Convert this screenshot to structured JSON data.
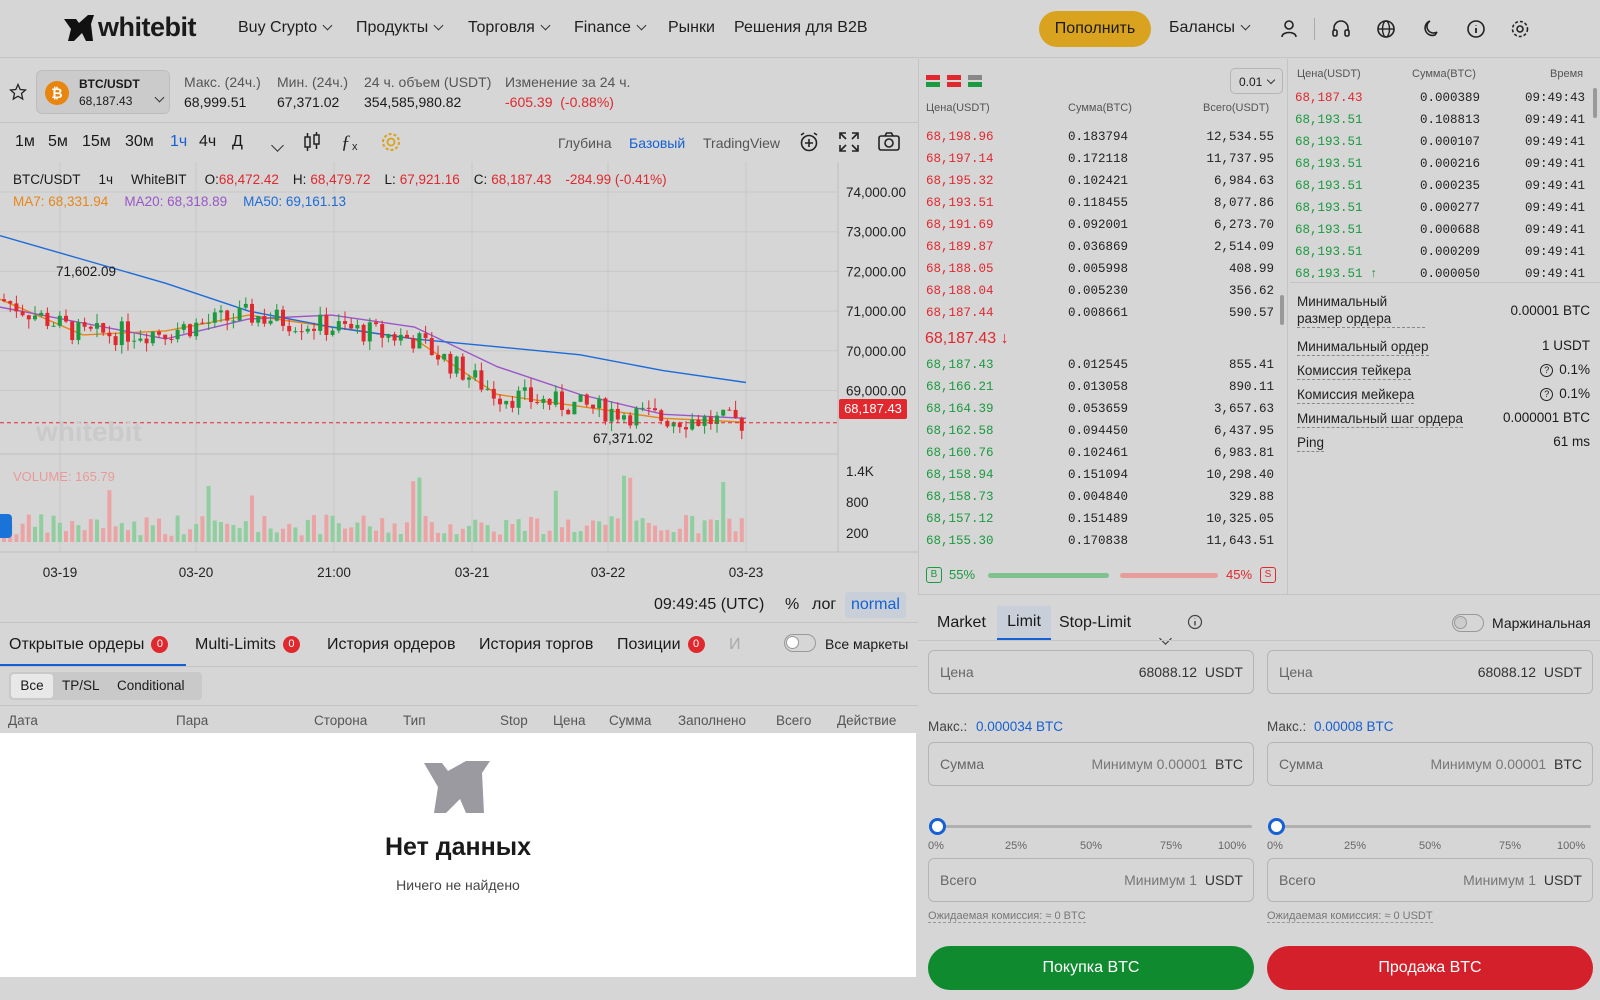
{
  "brand": {
    "name": "whitebit"
  },
  "nav": {
    "items": [
      "Buy Crypto",
      "Продукты",
      "Торговля",
      "Finance",
      "Рынки",
      "Решения для B2B"
    ],
    "deposit": "Пополнить",
    "balances": "Балансы"
  },
  "ticker": {
    "pair": "BTC/USDT",
    "price": "68,187.43",
    "stats": [
      {
        "label": "Макс. (24ч.)",
        "value": "68,999.51"
      },
      {
        "label": "Мин. (24ч.)",
        "value": "67,371.02"
      },
      {
        "label": "24 ч. объем (USDT)",
        "value": "354,585,980.82"
      },
      {
        "label": "Изменение за 24 ч.",
        "value": "-605.39  (-0.88%)"
      }
    ]
  },
  "chart_toolbar": {
    "timeframes": [
      "1м",
      "5м",
      "15м",
      "30м",
      "1ч",
      "4ч",
      "Д"
    ],
    "active": "1ч",
    "views": [
      "Глубина",
      "Базовый",
      "TradingView"
    ],
    "active_view": "Базовый"
  },
  "chart_legend": {
    "pair": "BTC/USDT",
    "interval": "1ч",
    "exchange": "WhiteBIT",
    "o_label": "O:",
    "o": "68,472.42",
    "h_label": "H:",
    "h": "68,479.72",
    "l_label": "L:",
    "l": "67,921.16",
    "c_label": "C:",
    "c": "68,187.43",
    "change": "-284.99 (-0.41%)",
    "ma7": "MA7: 68,331.94",
    "ma20": "MA20: 68,318.89",
    "ma50": "MA50: 69,161.13",
    "volume": "VOLUME: 165.79",
    "high_mark": "71,602.09",
    "low_mark": "67,371.02",
    "last_price_tag": "68,187.43"
  },
  "chart_data": {
    "type": "line",
    "x": [
      "03-19",
      "03-20",
      "21:00",
      "03-21",
      "03-22",
      "03-23"
    ],
    "ylim": [
      67000,
      74500
    ],
    "y_ticks": [
      "74,000.00",
      "73,000.00",
      "72,000.00",
      "71,000.00",
      "70,000.00",
      "69,000.00"
    ],
    "volume_ticks": [
      "1.4K",
      "800",
      "200"
    ],
    "series": [
      {
        "name": "MA7",
        "values": [
          71300,
          70400,
          70500,
          70900,
          70600,
          70300,
          68900,
          68600,
          68300,
          68200
        ]
      },
      {
        "name": "MA20",
        "values": [
          71100,
          70700,
          70300,
          70800,
          70900,
          70600,
          69600,
          68900,
          68400,
          68300
        ]
      },
      {
        "name": "MA50",
        "values": [
          72900,
          72300,
          71700,
          71000,
          70600,
          70300,
          70100,
          69900,
          69500,
          69200
        ]
      }
    ]
  },
  "chart_footer": {
    "time": "09:49:45 (UTC)",
    "pct": "%",
    "log": "лог",
    "mode": "normal"
  },
  "orderbook": {
    "precision": "0.01",
    "headers": [
      "Цена(USDT)",
      "Сумма(BTC)",
      "Всего(USDT)"
    ],
    "asks": [
      [
        "68,198.96",
        "0.183794",
        "12,534.55"
      ],
      [
        "68,197.14",
        "0.172118",
        "11,737.95"
      ],
      [
        "68,195.32",
        "0.102421",
        "6,984.63"
      ],
      [
        "68,193.51",
        "0.118455",
        "8,077.86"
      ],
      [
        "68,191.69",
        "0.092001",
        "6,273.70"
      ],
      [
        "68,189.87",
        "0.036869",
        "2,514.09"
      ],
      [
        "68,188.05",
        "0.005998",
        "408.99"
      ],
      [
        "68,188.04",
        "0.005230",
        "356.62"
      ],
      [
        "68,187.44",
        "0.008661",
        "590.57"
      ]
    ],
    "mid": "68,187.43 ↓",
    "bids": [
      [
        "68,187.43",
        "0.012545",
        "855.41"
      ],
      [
        "68,166.21",
        "0.013058",
        "890.11"
      ],
      [
        "68,164.39",
        "0.053659",
        "3,657.63"
      ],
      [
        "68,162.58",
        "0.094450",
        "6,437.95"
      ],
      [
        "68,160.76",
        "0.102461",
        "6,983.81"
      ],
      [
        "68,158.94",
        "0.151094",
        "10,298.40"
      ],
      [
        "68,158.73",
        "0.004840",
        "329.88"
      ],
      [
        "68,157.12",
        "0.151489",
        "10,325.05"
      ],
      [
        "68,155.30",
        "0.170838",
        "11,643.51"
      ]
    ],
    "buy_pct": "55%",
    "sell_pct": "45%",
    "buy_letter": "B",
    "sell_letter": "S"
  },
  "trades": {
    "headers": [
      "Цена(USDT)",
      "Сумма(BTC)",
      "Время"
    ],
    "rows": [
      [
        "68,187.43",
        "0.000389",
        "09:49:43",
        "red"
      ],
      [
        "68,193.51",
        "0.108813",
        "09:49:41",
        "green"
      ],
      [
        "68,193.51",
        "0.000107",
        "09:49:41",
        "green"
      ],
      [
        "68,193.51",
        "0.000216",
        "09:49:41",
        "green"
      ],
      [
        "68,193.51",
        "0.000235",
        "09:49:41",
        "green"
      ],
      [
        "68,193.51",
        "0.000277",
        "09:49:41",
        "green"
      ],
      [
        "68,193.51",
        "0.000688",
        "09:49:41",
        "green"
      ],
      [
        "68,193.51",
        "0.000209",
        "09:49:41",
        "green"
      ],
      [
        "68,193.51 ↑",
        "0.000050",
        "09:49:41",
        "green"
      ]
    ]
  },
  "market_info": [
    {
      "label": "Минимальный размер ордера",
      "value": "0.00001 BTC"
    },
    {
      "label": "Минимальный ордер",
      "value": "1 USDT"
    },
    {
      "label": "Комиссия тейкера",
      "value": "0.1%"
    },
    {
      "label": "Комиссия мейкера",
      "value": "0.1%"
    },
    {
      "label": "Минимальный шаг ордера",
      "value": "0.000001 BTC"
    },
    {
      "label": "Ping",
      "value": "61 ms"
    }
  ],
  "orders": {
    "tabs": [
      {
        "label": "Открытые ордеры",
        "count": "0"
      },
      {
        "label": "Multi-Limits",
        "count": "0"
      },
      {
        "label": "История ордеров"
      },
      {
        "label": "История торгов"
      },
      {
        "label": "Позиции",
        "count": "0"
      },
      {
        "label": "И"
      }
    ],
    "all_markets": "Все маркеты",
    "filters": [
      "Все",
      "TP/SL",
      "Conditional"
    ],
    "columns": [
      "Дата",
      "Пара",
      "Сторона",
      "Тип",
      "Stop",
      "Цена",
      "Сумма",
      "Заполнено",
      "Всего",
      "Действие"
    ],
    "empty_title": "Нет данных",
    "empty_sub": "Ничего не найдено"
  },
  "form": {
    "tabs": [
      "Market",
      "Limit",
      "Stop-Limit"
    ],
    "active": "Limit",
    "margin": "Маржинальная",
    "buy": {
      "price_label": "Цена",
      "price": "68088.12",
      "price_unit": "USDT",
      "max_label": "Макс.:",
      "max": "0.000034 BTC",
      "amount_label": "Сумма",
      "amount_ph": "Минимум 0.00001",
      "amount_unit": "BTC",
      "total_label": "Всего",
      "total_ph": "Минимум 1",
      "total_unit": "USDT",
      "fee": "Ожидаемая комиссия: ≈ 0 BTC",
      "button": "Покупка BTC"
    },
    "sell": {
      "price_label": "Цена",
      "price": "68088.12",
      "price_unit": "USDT",
      "max_label": "Макс.:",
      "max": "0.00008 BTC",
      "amount_label": "Сумма",
      "amount_ph": "Минимум 0.00001",
      "amount_unit": "BTC",
      "total_label": "Всего",
      "total_ph": "Минимум 1",
      "total_unit": "USDT",
      "fee": "Ожидаемая комиссия: ≈ 0 USDT",
      "button": "Продажа BTC"
    },
    "slider_marks": [
      "0%",
      "25%",
      "50%",
      "75%",
      "100%"
    ]
  },
  "colors": {
    "accent": "#d9a21f",
    "buy": "#0f8a2f",
    "sell": "#d3202a",
    "blue": "#1560d4"
  }
}
